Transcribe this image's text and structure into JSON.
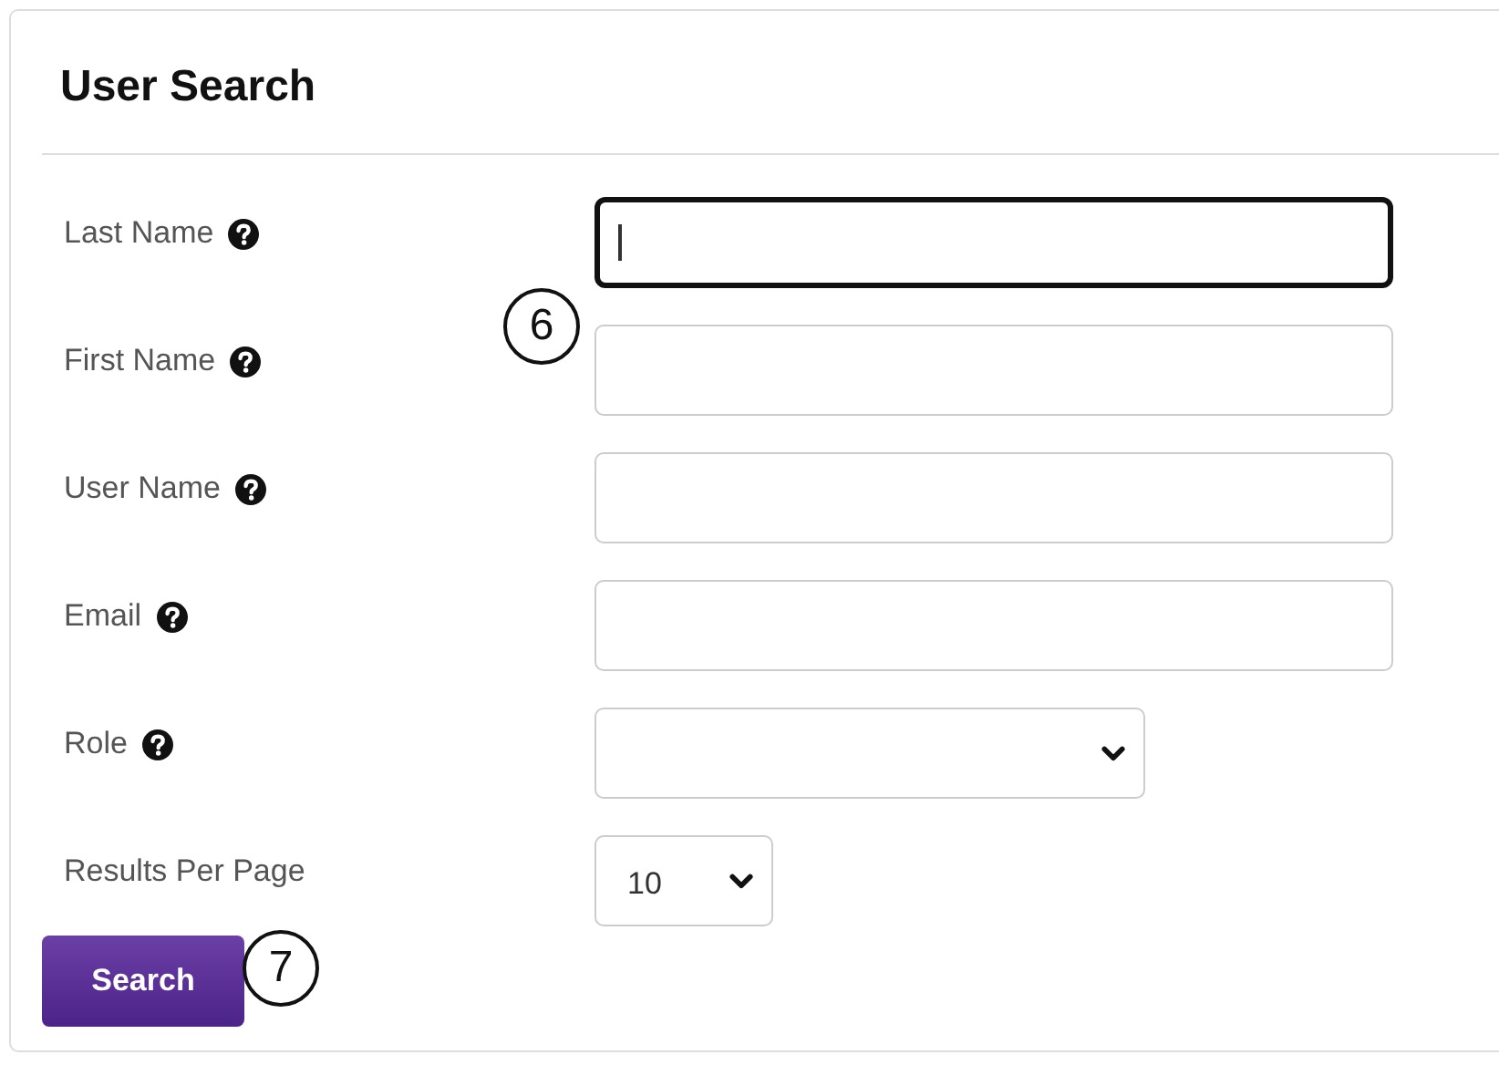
{
  "title": "User Search",
  "fields": [
    {
      "label": "Last Name",
      "kind": "text",
      "help": true,
      "focused": true
    },
    {
      "label": "First Name",
      "kind": "text",
      "help": true,
      "focused": false
    },
    {
      "label": "User Name",
      "kind": "text",
      "help": true,
      "focused": false
    },
    {
      "label": "Email",
      "kind": "text",
      "help": true,
      "focused": false
    },
    {
      "label": "Role",
      "kind": "select",
      "help": true,
      "focused": false
    },
    {
      "label": "Results Per Page",
      "kind": "select",
      "value": "10",
      "help": false,
      "focused": false
    }
  ],
  "button": "Search",
  "callouts": [
    {
      "text": "6"
    },
    {
      "text": "7"
    }
  ]
}
